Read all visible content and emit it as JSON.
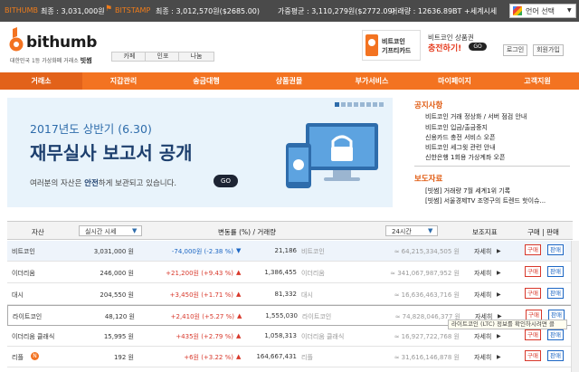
{
  "ticker": {
    "bithumb_label": "BITHUMB",
    "bithumb_price": "최종 : 3,031,000원",
    "bitstamp_label": "BITSTAMP",
    "bitstamp_price": "최종 : 3,012,570원($2685.00)",
    "avg": "가중평균 : 3,110,279원($2772.09)",
    "volume": "거래량 : 12636.89BT",
    "world": "+세계시세",
    "lang_label": "언어 선택",
    "lang_arrow": "▼"
  },
  "header": {
    "logo_text": "bithumb",
    "logo_sub_a": "대한민국 1등 가상화폐 거래소 ",
    "logo_sub_b": "빗썸",
    "tabs": [
      "카페",
      "인포",
      "나눔"
    ],
    "ad1_line1": "비트코인",
    "ad1_line2": "기프티카드",
    "ad2_line1": "비트코인 상품권",
    "ad2_line2": "충전하기!",
    "ad2_go": "GO",
    "login": "로그인",
    "signup": "회원가입"
  },
  "nav": [
    "거래소",
    "지갑관리",
    "송금대행",
    "상품권몰",
    "부가서비스",
    "마이페이지",
    "고객지원"
  ],
  "banner": {
    "line1": "2017년도 상반기 (6.30)",
    "line2": "재무실사 보고서 공개",
    "line3a": "여러분의 자산은 ",
    "line3b": "안전",
    "line3c": "하게 보관되고 있습니다.",
    "go": "GO"
  },
  "notices": {
    "title": "공지사항",
    "items": [
      "비트코인 거래 정상화 / 서버 점검 안내",
      "비트코인 입금/출금중지",
      "신용카드 충전 서비스 오픈",
      "비트코인 세그윗 관련 안내",
      "신한은행 1회용 가상계좌 오픈"
    ]
  },
  "press": {
    "title": "보도자료",
    "items": [
      "[빗썸] 거래량 7월 세계1위 기록",
      "[빗썸] 서울경제TV 조명구의 트렌드 핫이슈..."
    ]
  },
  "table": {
    "h_asset": "자산",
    "h_select": "실시간 시세",
    "h_change": "변동률 (%) / 거래량",
    "h_period": "24시간",
    "h_info": "보조지표",
    "h_trade": "구매 | 판매",
    "detail": "자세히",
    "buy": "구매",
    "sell": "판매",
    "rows": [
      {
        "name": "비트코인",
        "price": "3,031,000 원",
        "change": "-74,000원 (-2.38 %)",
        "dir": "down",
        "arrow": "▼",
        "vol": "21,186",
        "vol_name": "비트코인",
        "eq": "≈ 64,215,334,505 원"
      },
      {
        "name": "이더리움",
        "price": "246,000 원",
        "change": "+21,200원 (+9.43 %)",
        "dir": "up",
        "arrow": "▲",
        "vol": "1,386,455",
        "vol_name": "이더리움",
        "eq": "≈ 341,067,987,952 원"
      },
      {
        "name": "대시",
        "price": "204,550 원",
        "change": "+3,450원 (+1.71 %)",
        "dir": "up",
        "arrow": "▲",
        "vol": "81,332",
        "vol_name": "대시",
        "eq": "≈ 16,636,463,716 원"
      },
      {
        "name": "라이트코인",
        "price": "48,120 원",
        "change": "+2,410원 (+5.27 %)",
        "dir": "up",
        "arrow": "▲",
        "vol": "1,555,030",
        "vol_name": "라이트코인",
        "eq": "≈ 74,828,046,377 원"
      },
      {
        "name": "이더리움 클래식",
        "price": "15,995 원",
        "change": "+435원 (+2.79 %)",
        "dir": "up",
        "arrow": "▲",
        "vol": "1,058,313",
        "vol_name": "이더리움 클래식",
        "eq": "≈ 16,927,722,768 원"
      },
      {
        "name": "리플",
        "price": "192 원",
        "change": "+6원 (+3.22 %)",
        "dir": "up",
        "arrow": "▲",
        "vol": "164,667,431",
        "vol_name": "리플",
        "eq": "≈ 31,616,146,878 원"
      }
    ],
    "tooltip": "라이트코인 (LTC) 정보를 확인하시려면 클"
  },
  "colors": {
    "brand": "#f37321",
    "up": "#d8382b",
    "down": "#1d67c4",
    "ticker_bg": "#4a4a4a"
  }
}
